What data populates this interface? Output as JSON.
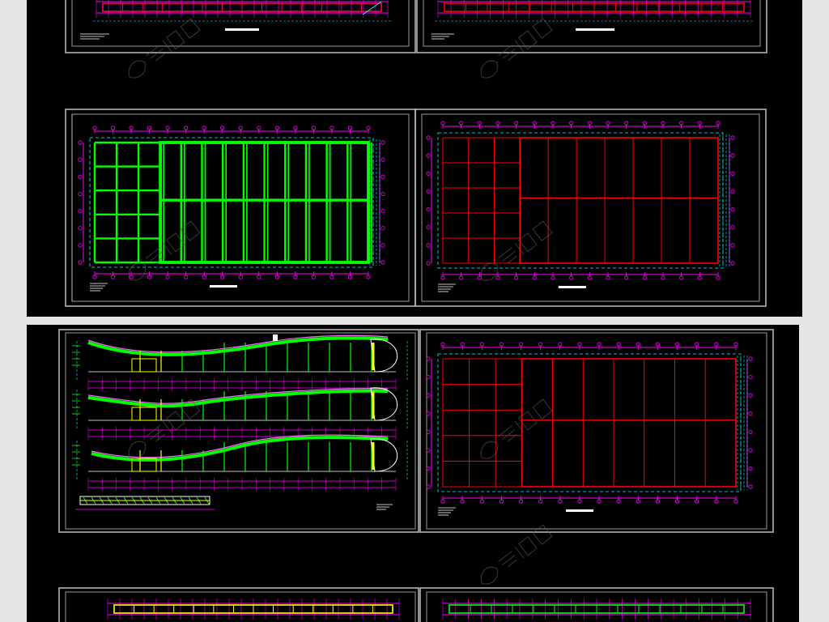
{
  "colors": {
    "page_background": "#e4e6e8",
    "board_background": "#000000",
    "frame": "#bfbfbf",
    "axis_grid": "#ff00ff",
    "dim_lines": "#00ffff",
    "steel_member_green": "#00ff00",
    "steel_member_red": "#ff0000",
    "section_yellow": "#ffff00",
    "roof_curve": "#ff66ff",
    "text_white": "#ffffff"
  },
  "boards": [
    {
      "id": "board-top",
      "sheets": [
        {
          "id": "sheet-1",
          "kind": "plan-strip",
          "member_color": "#ff0066"
        },
        {
          "id": "sheet-2",
          "kind": "plan-strip",
          "member_color": "#ff0000"
        },
        {
          "id": "sheet-3",
          "kind": "plan-grid",
          "member_color": "#00ff00"
        },
        {
          "id": "sheet-4",
          "kind": "plan-grid",
          "member_color": "#ff0000"
        }
      ]
    },
    {
      "id": "board-middle",
      "sheets": [
        {
          "id": "sheet-5",
          "kind": "elevations",
          "member_color": "#00ff00"
        },
        {
          "id": "sheet-6",
          "kind": "plan-grid",
          "member_color": "#ff0000"
        }
      ]
    },
    {
      "id": "board-bottom",
      "sheets": [
        {
          "id": "sheet-7",
          "kind": "plan-strip",
          "member_color": "#ffff00"
        },
        {
          "id": "sheet-8",
          "kind": "plan-strip",
          "member_color": "#00ff00"
        }
      ]
    }
  ],
  "watermark": {
    "icon": "watermark-logo-icon",
    "count": 6
  }
}
